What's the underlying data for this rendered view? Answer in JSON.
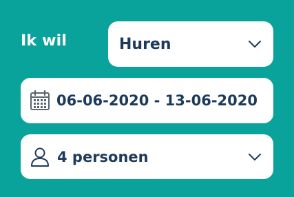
{
  "intent": {
    "label": "Ik wil",
    "selected": "Huren"
  },
  "dates": {
    "value": "06-06-2020 - 13-06-2020",
    "icon": "calendar-icon"
  },
  "guests": {
    "value": "4 personen",
    "icon": "person-icon"
  },
  "colors": {
    "background": "#0aa39c",
    "field": "#ffffff",
    "text": "#1d3a5a",
    "icon": "#5a6570"
  }
}
